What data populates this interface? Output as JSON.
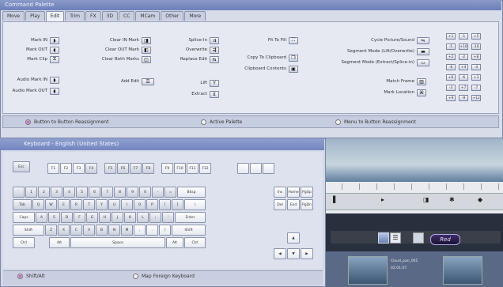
{
  "palette": {
    "title": "Command Palette",
    "tabs": [
      "Move",
      "Play",
      "Edit",
      "Trim",
      "FX",
      "3D",
      "CC",
      "MCam",
      "Other",
      "More"
    ],
    "active_tab": "Edit",
    "col1": [
      {
        "label": "Mark IN",
        "icon": "mark-in-icon",
        "glyph": "◗"
      },
      {
        "label": "Mark OUT",
        "icon": "mark-out-icon",
        "glyph": "◖"
      },
      {
        "label": "Mark Clip",
        "icon": "mark-clip-icon",
        "glyph": "⧖"
      },
      {
        "label": "Audio Mark IN",
        "icon": "audio-mark-in-icon",
        "glyph": "◗"
      },
      {
        "label": "Audio Mark OUT",
        "icon": "audio-mark-out-icon",
        "glyph": "◖"
      }
    ],
    "col2": [
      {
        "label": "Clear IN Mark",
        "icon": "clear-in-icon",
        "glyph": "◨"
      },
      {
        "label": "Clear OUT Mark",
        "icon": "clear-out-icon",
        "glyph": "◧"
      },
      {
        "label": "Clear Both Marks",
        "icon": "clear-both-icon",
        "glyph": "◫"
      },
      {
        "label": "Add Edit",
        "icon": "add-edit-icon",
        "glyph": "☰"
      }
    ],
    "col3": [
      {
        "label": "Splice-In",
        "icon": "splice-in-icon",
        "glyph": "⇉"
      },
      {
        "label": "Overwrite",
        "icon": "overwrite-icon",
        "glyph": "⇶"
      },
      {
        "label": "Replace Edit",
        "icon": "replace-edit-icon",
        "glyph": "⇆"
      },
      {
        "label": "Lift",
        "icon": "lift-icon",
        "glyph": "Y"
      },
      {
        "label": "Extract",
        "icon": "extract-icon",
        "glyph": "⊻"
      }
    ],
    "col4": [
      {
        "label": "Fit To Fill",
        "icon": "fit-to-fill-icon",
        "glyph": "⛶"
      },
      {
        "label": "Copy To Clipboard",
        "icon": "copy-clipboard-icon",
        "glyph": "❐"
      },
      {
        "label": "Clipboard Contents",
        "icon": "clipboard-contents-icon",
        "glyph": "▣"
      }
    ],
    "col5": [
      {
        "label": "Cycle Picture/Sound",
        "icon": "cycle-picture-sound-icon",
        "glyph": "⇋"
      },
      {
        "label": "Segment Mode (Lift/Overwrite)",
        "icon": "segment-lift-icon",
        "glyph": "▬"
      },
      {
        "label": "Segment Mode (Extract/Splice-in)",
        "icon": "segment-extract-icon",
        "glyph": "▭"
      },
      {
        "label": "Match Frame",
        "icon": "match-frame-icon",
        "glyph": "▥"
      },
      {
        "label": "Mark Location",
        "icon": "mark-location-icon",
        "glyph": "⌘"
      }
    ],
    "grid_buttons": [
      "+1",
      "-1",
      "+5",
      "-5",
      "+10",
      "-10",
      "+2",
      "-2",
      "+8",
      "-8",
      "+4",
      "-4",
      "+6",
      "-6",
      "+3",
      "-3",
      "+7",
      "-7",
      "+9",
      "-9",
      "+12"
    ],
    "footer": {
      "option1": "Button to Button Reassignment",
      "option2": "Active Palette",
      "option3": "Menu to Button Reassignment"
    }
  },
  "keyboard": {
    "title": "Keyboard - English (United States)",
    "rows": {
      "fn_row": [
        "Esc",
        "F1",
        "F2",
        "F3",
        "F4",
        "F5",
        "F6",
        "F7",
        "F8",
        "F9",
        "F10",
        "F11",
        "F12",
        "",
        "",
        ""
      ],
      "num_row": [
        "`",
        "1",
        "2",
        "3",
        "4",
        "5",
        "6",
        "7",
        "8",
        "9",
        "0",
        "-",
        "=",
        "Bksp"
      ],
      "q_row": [
        "Tab",
        "Q",
        "W",
        "E",
        "R",
        "T",
        "Y",
        "U",
        "I",
        "O",
        "P",
        "[",
        "]",
        "\\"
      ],
      "a_row": [
        "Caps",
        "A",
        "S",
        "D",
        "F",
        "G",
        "H",
        "J",
        "K",
        "L",
        ";",
        "'",
        "Enter"
      ],
      "z_row": [
        "Shift",
        "Z",
        "X",
        "C",
        "V",
        "B",
        "N",
        "M",
        ",",
        ".",
        "/",
        "Shift"
      ],
      "space_row": [
        "Ctrl",
        "Alt",
        "Space",
        "Alt",
        "Ctrl"
      ],
      "nav_keys": [
        "Ins",
        "Home",
        "PgUp",
        "Del",
        "End",
        "PgDn"
      ],
      "arrow_keys": [
        "◀",
        "▲",
        "▼",
        "▶"
      ]
    },
    "footer": {
      "option1": "Shift/Alt",
      "option2": "Map Foreign Keyboard"
    }
  },
  "timeline": {
    "record_label": "Red"
  },
  "bin": {
    "clip1": "Cloud_pan_001",
    "clip2": "02:01:07"
  },
  "colors": {
    "title_bar": "#7386c0",
    "panel": "#d7dce8",
    "radio_on": "#c070c0"
  }
}
